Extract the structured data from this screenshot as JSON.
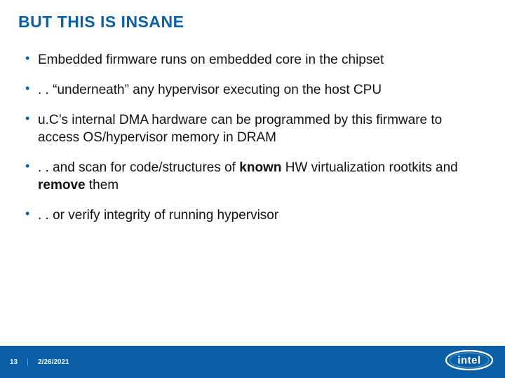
{
  "title": "BUT THIS IS INSANE",
  "bullets": [
    {
      "pre": "Embedded firmware runs on embedded core in the chipset",
      "bold": "",
      "post": ""
    },
    {
      "pre": ". . “underneath” any hypervisor executing on the host CPU",
      "bold": "",
      "post": ""
    },
    {
      "pre": "u.C’s internal DMA hardware can be programmed by this firmware to access OS/hypervisor memory in DRAM",
      "bold": "",
      "post": ""
    },
    {
      "pre": ". . and scan for code/structures of ",
      "bold": "known",
      "post": " HW virtualization rootkits and ",
      "bold2": "remove",
      "post2": " them"
    },
    {
      "pre": ". . or verify integrity of running hypervisor",
      "bold": "",
      "post": ""
    }
  ],
  "footer": {
    "page": "13",
    "date": "2/26/2021"
  },
  "logo": {
    "brand": "intel"
  }
}
